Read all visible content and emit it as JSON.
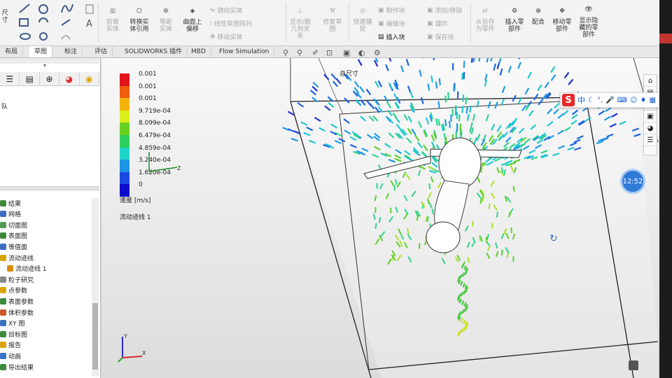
{
  "ribbon": {
    "sketch_labels": [
      "尺",
      "寸"
    ],
    "convert_button": "转换实\n体引用",
    "curve_offset_button": "曲面上\n偏移",
    "small_tools": [
      "镜向实体",
      "线性草图阵列",
      "移动实体"
    ],
    "block_tools": [
      "制作块",
      "编辑块",
      "插入块",
      "添加/移除",
      "爆炸",
      "保存块"
    ],
    "insert_part_button": "插入零\n部件",
    "mate_button": "配合",
    "move_part_button": "移动零\n部件",
    "show_hidden_button": "显示隐\n藏的零\n部件"
  },
  "tabs": [
    "布局",
    "草图",
    "标注",
    "评估",
    "SOLIDWORKS 插件",
    "MBD",
    "Flow Simulation"
  ],
  "left_panel": {
    "tree_header": "队",
    "tree_items": [
      "结果",
      "网格",
      "切面图",
      "表面图",
      "等值面",
      "流动迹线",
      "流动迹线 1",
      "粒子研究",
      "点参数",
      "表面参数",
      "体积参数",
      "XY 图",
      "目标图",
      "报告",
      "动画",
      "导出结果"
    ]
  },
  "legend": {
    "values": [
      "0.001",
      "0.001",
      "0.001",
      "9.719e-04",
      "8.099e-04",
      "6.479e-04",
      "4.859e-04",
      "3.240e-04",
      "1.620e-04",
      "0"
    ],
    "title": "速度 [m/s]",
    "plot_name": "流动迹线 1"
  },
  "viewport": {
    "model_label": "总尺寸"
  },
  "ime": {
    "logo": "S",
    "mode": "中"
  },
  "clock": {
    "time": "12:52"
  },
  "colors": {
    "legend": [
      "#e3141a",
      "#f25d0d",
      "#f4b40d",
      "#d9ef1b",
      "#68d11e",
      "#2bd15d",
      "#1ed4c8",
      "#1c95e6",
      "#1a49e4",
      "#0c0ccc"
    ]
  }
}
